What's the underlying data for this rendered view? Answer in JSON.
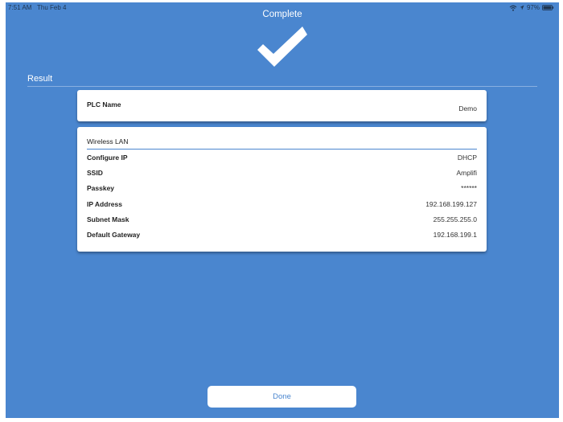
{
  "status_bar": {
    "time": "7:51 AM",
    "date": "Thu Feb 4",
    "battery": "97%"
  },
  "nav": {
    "title": "Complete"
  },
  "result": {
    "section_label": "Result",
    "plc": {
      "label": "PLC Name",
      "value": "Demo"
    },
    "wireless_lan": {
      "header": "Wireless LAN",
      "rows": [
        {
          "label": "Configure IP",
          "value": "DHCP"
        },
        {
          "label": "SSID",
          "value": "Amplifi"
        },
        {
          "label": "Passkey",
          "value": "******"
        },
        {
          "label": "IP Address",
          "value": "192.168.199.127"
        },
        {
          "label": "Subnet Mask",
          "value": "255.255.255.0"
        },
        {
          "label": "Default Gateway",
          "value": "192.168.199.1"
        }
      ]
    }
  },
  "actions": {
    "done_label": "Done"
  },
  "icons": {
    "success": "checkmark-icon",
    "wifi": "wifi-icon",
    "location": "location-icon",
    "battery": "battery-icon"
  },
  "colors": {
    "background": "#4a86cf",
    "card": "#ffffff",
    "accent": "#4a86cf"
  }
}
